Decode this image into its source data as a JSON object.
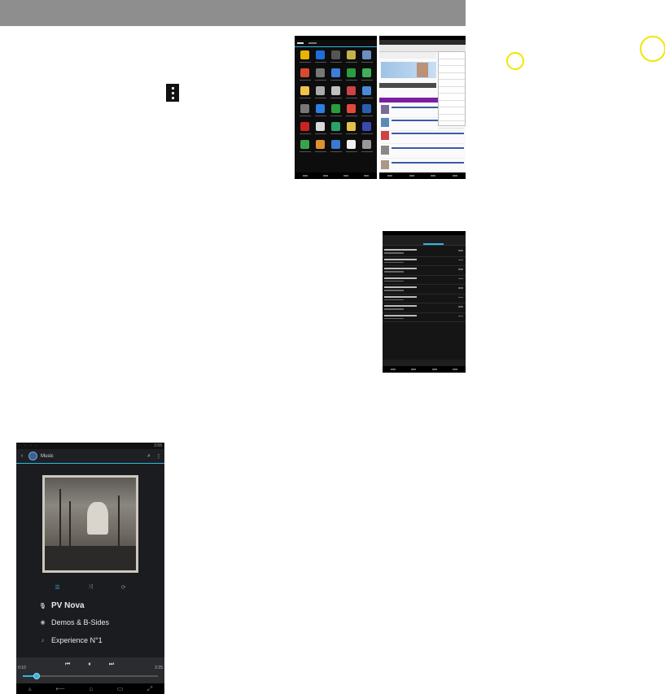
{
  "music": {
    "status_time": "3:55",
    "app_title": "Music",
    "artist": "PV Nova",
    "album": "Demos & B-Sides",
    "track": "Experience N°1",
    "time_elapsed": "0:10",
    "time_total": "2:25",
    "progress": 0.1,
    "icons": {
      "back": "‹",
      "search": "⌕",
      "overflow": "⋮",
      "queue": "☰",
      "shuffle": "⤨",
      "repeat": "⟳",
      "artist": "🎙",
      "album": "◉",
      "track": "♪",
      "prev": "⏮",
      "pause": "⏸",
      "next": "⏭",
      "nav_back": "⟵",
      "nav_home": "⌂",
      "nav_recent": "▭",
      "nav_expand": "⤢"
    }
  },
  "colors": {
    "accent": "#33b5e5",
    "highlight_circle": "#f2e600",
    "header_bar": "#8e8e8e"
  }
}
